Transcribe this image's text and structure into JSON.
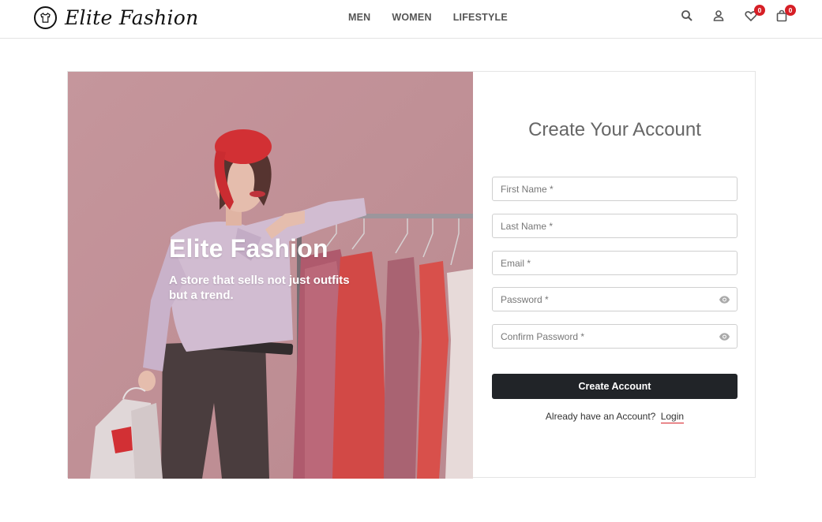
{
  "header": {
    "brand": "Elite Fashion",
    "nav": [
      {
        "label": "MEN"
      },
      {
        "label": "WOMEN"
      },
      {
        "label": "LIFESTYLE"
      }
    ],
    "icons": {
      "search": "search-icon",
      "account": "user-icon",
      "wishlist": "heart-icon",
      "cart": "bag-icon"
    },
    "wishlist_count": "0",
    "cart_count": "0"
  },
  "hero": {
    "title": "Elite Fashion",
    "subtitle": "A store that sells not just outfits but a trend."
  },
  "form": {
    "title": "Create Your Account",
    "first_name_placeholder": "First Name *",
    "last_name_placeholder": "Last Name *",
    "email_placeholder": "Email *",
    "password_placeholder": "Password *",
    "confirm_password_placeholder": "Confirm Password *",
    "submit_label": "Create Account",
    "login_prompt": "Already have an Account?",
    "login_link": "Login"
  },
  "colors": {
    "accent": "#d61f26",
    "button": "#212428",
    "hero_bg": "#c5979c"
  }
}
